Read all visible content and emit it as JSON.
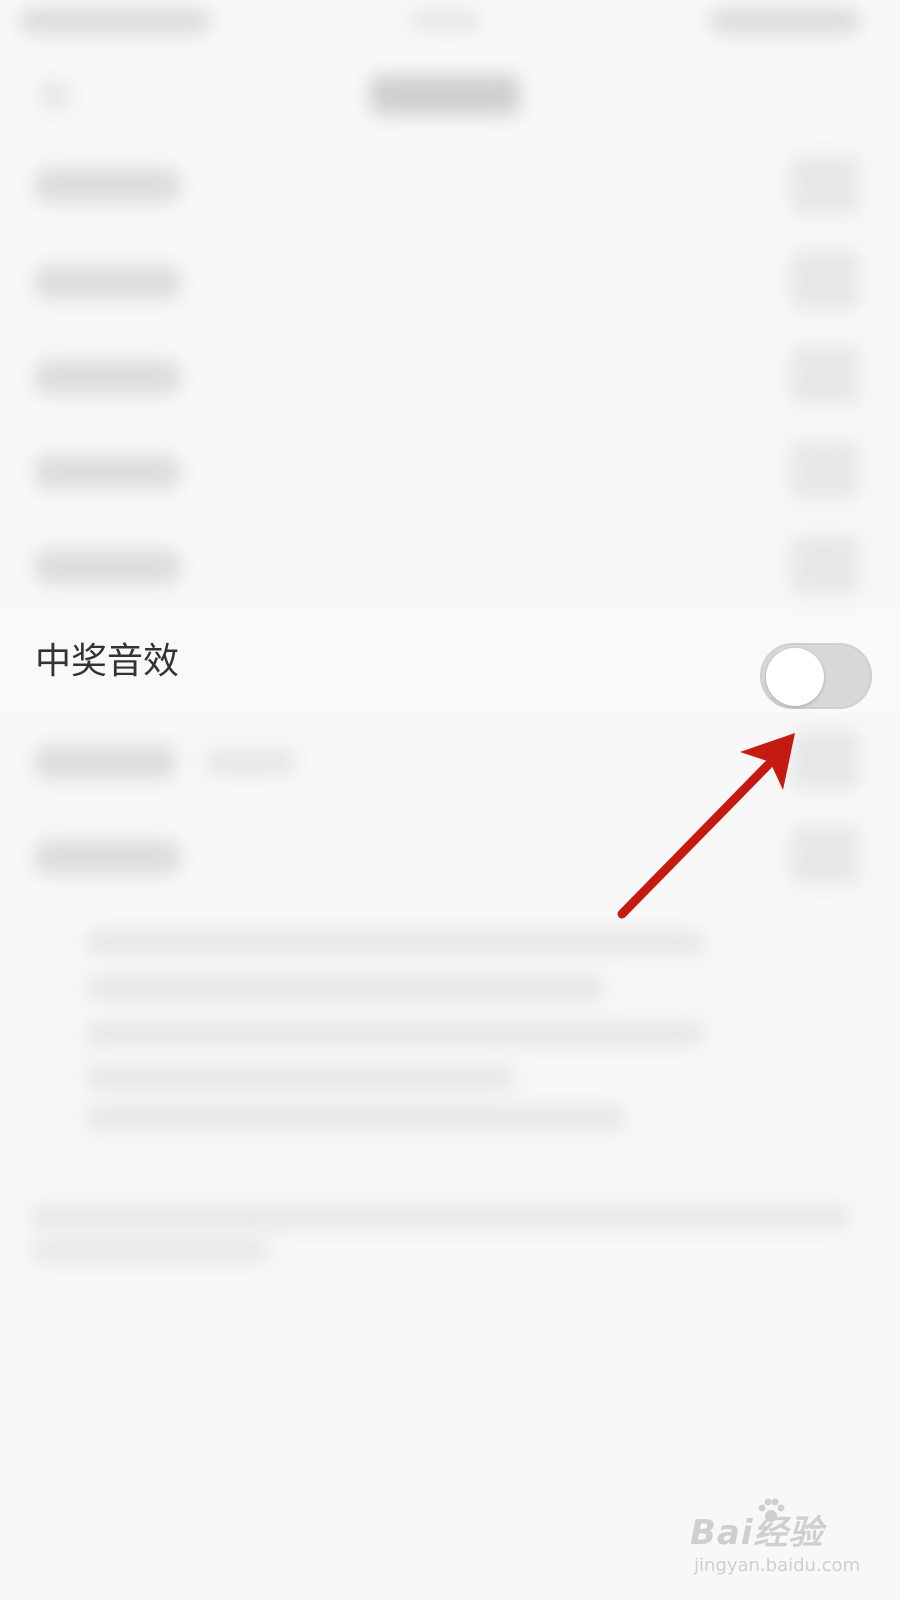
{
  "settings": {
    "win_sound": {
      "label": "中奖音效",
      "enabled": false
    }
  },
  "watermark": {
    "brand": "Bai经验",
    "url": "jingyan.baidu.com"
  },
  "colors": {
    "arrow": "#c41a12",
    "switch_off": "#d8d8d8",
    "background": "#f8f8f8",
    "label": "#333333"
  },
  "icons": [
    "paw-icon"
  ]
}
